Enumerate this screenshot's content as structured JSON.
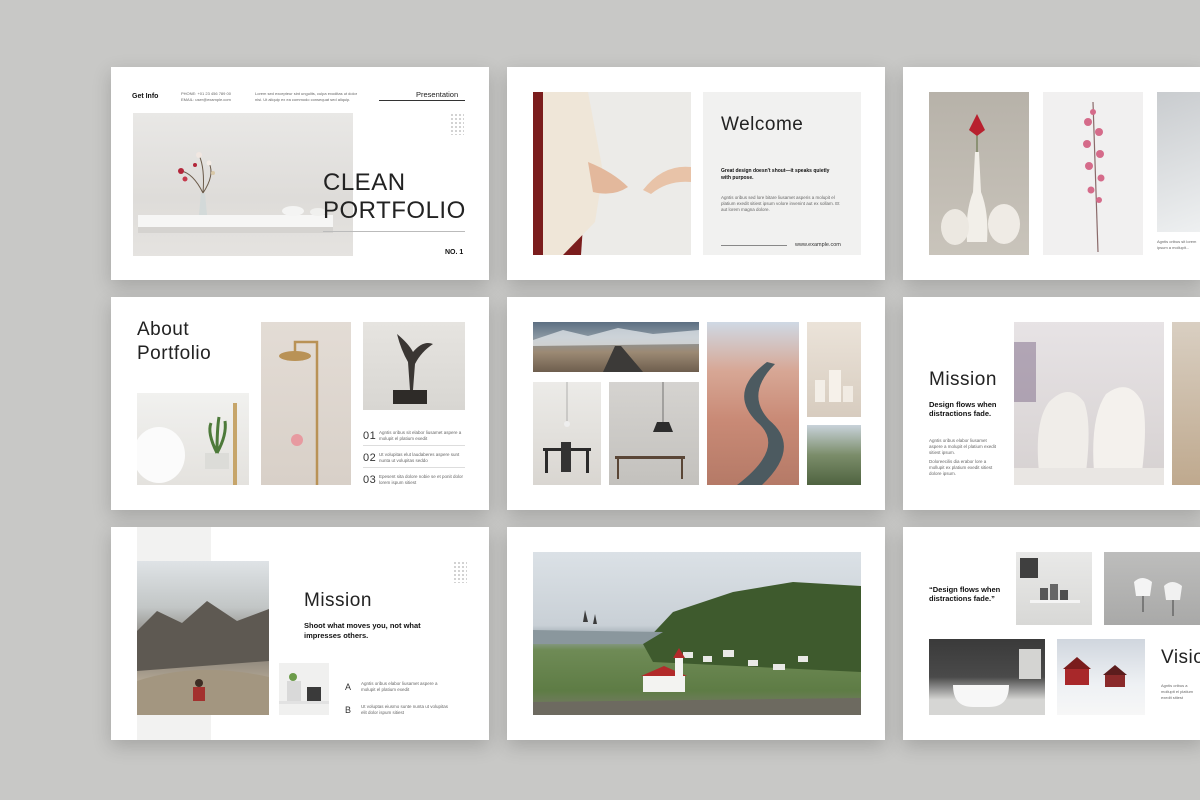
{
  "s1": {
    "get_info": "Get Info",
    "contact": "PHONE: +01 23 456 789 00\nEMAIL: user@example.com",
    "intro": "Lorem sed excepteur sint ungulits, culpa exoditas ut dolor nisi. Ut aliquip ex ea commodo consequat sed aliquip.",
    "presentation": "Presentation",
    "title1": "CLEAN",
    "title2": "PORTFOLIO",
    "number": "NO. 1"
  },
  "s2": {
    "title": "Welcome",
    "subtitle": "Great design doesn't shout—it speaks quietly with purpose.",
    "body": "Agntis oribus sed lore bitare liusamet asperis a molupit el platium exedit sitiest ipsum volore invenint aut ex sollam. Et aut lorem magna dolore.",
    "url": "www.example.com"
  },
  "s3": {
    "body": "Agntis oribus sit lorem ipsum a mollupit..."
  },
  "s4": {
    "title1": "About",
    "title2": "Portfolio",
    "items": [
      {
        "num": "01",
        "text": "Agntis oribus sit elabor liusamet aspere a molupit el platium exedit"
      },
      {
        "num": "02",
        "text": "Ut volupitas elut laudaberes aspere sunt nunta ut volupitas seddo"
      },
      {
        "num": "03",
        "text": "Epesent sita dolore nobie se et ponit dolor lorem ispum sitiest"
      }
    ]
  },
  "s6": {
    "title": "Mission",
    "subtitle": "Design flows when distractions fade.",
    "body1": "Agntis oribus elabor liusamet aspere a molupit el platium exedit sitiest ipsum.",
    "body2": "Doloreecilis dia erabor lore a mollupit ex platium exedit sitiest dolore ipsum."
  },
  "s7": {
    "title": "Mission",
    "subtitle": "Shoot what moves you, not what impresses others.",
    "items": [
      {
        "letter": "A",
        "text": "Agntis oribus elabor liusamet aspere a molupit el platium exedit"
      },
      {
        "letter": "B",
        "text": "Ut voluptas eiusmo sunte nunta ut volupitas elit dolor ispum sitiest"
      }
    ]
  },
  "s9": {
    "quote": "“Design flows when distractions fade.”",
    "title": "Visio",
    "body": "Agntis oribus a mollupit el platium exedit sitiest"
  },
  "colors": {
    "background": "#c8c8c6",
    "slide": "#ffffff",
    "text": "#222222"
  }
}
